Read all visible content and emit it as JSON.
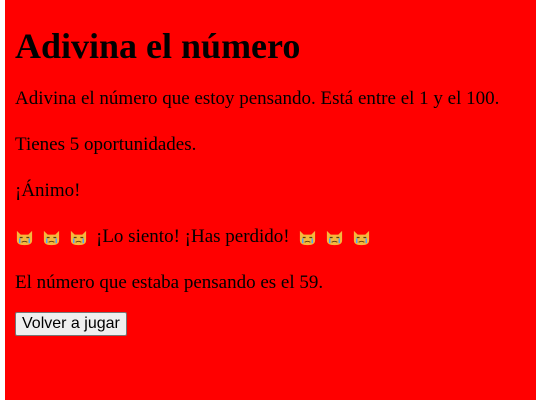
{
  "title": "Adivina el número",
  "intro": "Adivina el número que estoy pensando. Está entre el 1 y el 100.",
  "tries": "Tienes 5 oportunidades.",
  "cheer": "¡Ánimo!",
  "result": {
    "message": "¡Lo siento! ¡Has perdido!",
    "emoji_icon": "crying-cat-icon"
  },
  "reveal": "El número que estaba pensando es el 59.",
  "replay_button_label": "Volver a jugar",
  "colors": {
    "background": "#ff0000",
    "text": "#000000"
  }
}
